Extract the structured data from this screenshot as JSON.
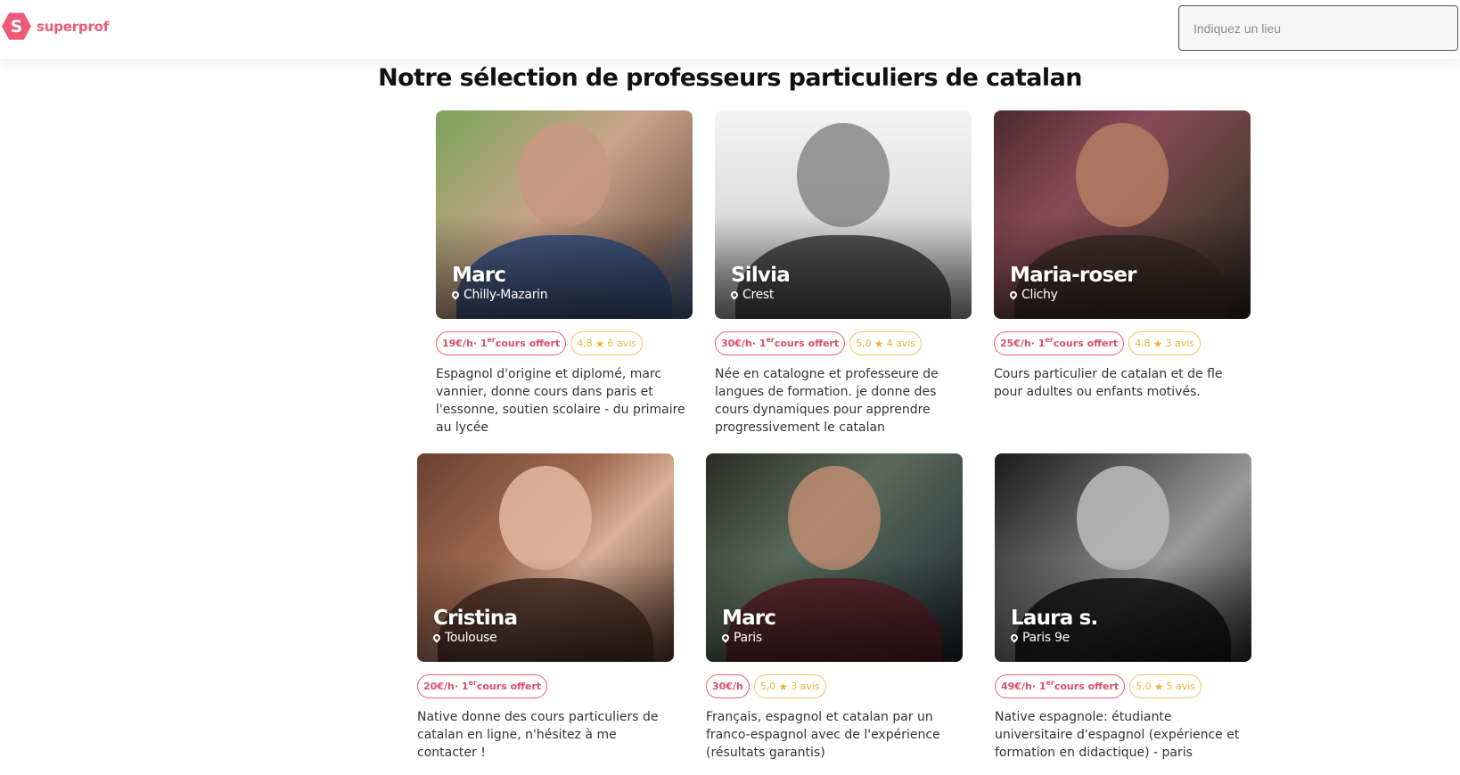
{
  "header": {
    "logo_letter": "S",
    "logo_text": "superprof",
    "search_placeholder": "Indiquez un lieu"
  },
  "title": "Notre sélection de professeurs particuliers de catalan",
  "colors": {
    "brand": "#ef5a79",
    "rating": "#f0b23a"
  },
  "teachers": [
    {
      "name": "Marc",
      "location": "Chilly-Mazarin",
      "price": "19€/h",
      "offer_prefix": " · 1",
      "offer_sup": "er",
      "offer_suffix": " cours offert",
      "rating": "4,8",
      "reviews": "6 avis",
      "description": "Espagnol d'origine et diplomé, marc vannier, donne cours dans paris et l'essonne, soutien scolaire - du primaire au lycée"
    },
    {
      "name": "Silvia",
      "location": "Crest",
      "price": "30€/h",
      "offer_prefix": " · 1",
      "offer_sup": "er",
      "offer_suffix": " cours offert",
      "rating": "5,0",
      "reviews": "4 avis",
      "description": "Née en catalogne et professeure de langues de formation. je donne des cours dynamiques pour apprendre progressivement le catalan"
    },
    {
      "name": "Maria-roser",
      "location": "Clichy",
      "price": "25€/h",
      "offer_prefix": " · 1",
      "offer_sup": "er",
      "offer_suffix": " cours offert",
      "rating": "4,8",
      "reviews": "3 avis",
      "description": "Cours particulier de catalan et de fle pour adultes ou enfants motivés."
    },
    {
      "name": "Cristina",
      "location": "Toulouse",
      "price": "20€/h",
      "offer_prefix": " · 1",
      "offer_sup": "er",
      "offer_suffix": " cours offert",
      "rating": "",
      "reviews": "",
      "description": "Native donne des cours particuliers de catalan en ligne, n'hésitez à me contacter !"
    },
    {
      "name": "Marc",
      "location": "Paris",
      "price": "30€/h",
      "offer_prefix": "",
      "offer_sup": "",
      "offer_suffix": "",
      "rating": "5,0",
      "reviews": "3 avis",
      "description": "Français, espagnol et catalan par un franco-espagnol avec de l'expérience (résultats garantis)"
    },
    {
      "name": "Laura s.",
      "location": "Paris 9e",
      "price": "49€/h",
      "offer_prefix": " · 1",
      "offer_sup": "er",
      "offer_suffix": " cours offert",
      "rating": "5,0",
      "reviews": "5 avis",
      "description": "Native espagnole: étudiante universitaire d'espagnol (expérience et formation en didactique) - paris"
    }
  ]
}
